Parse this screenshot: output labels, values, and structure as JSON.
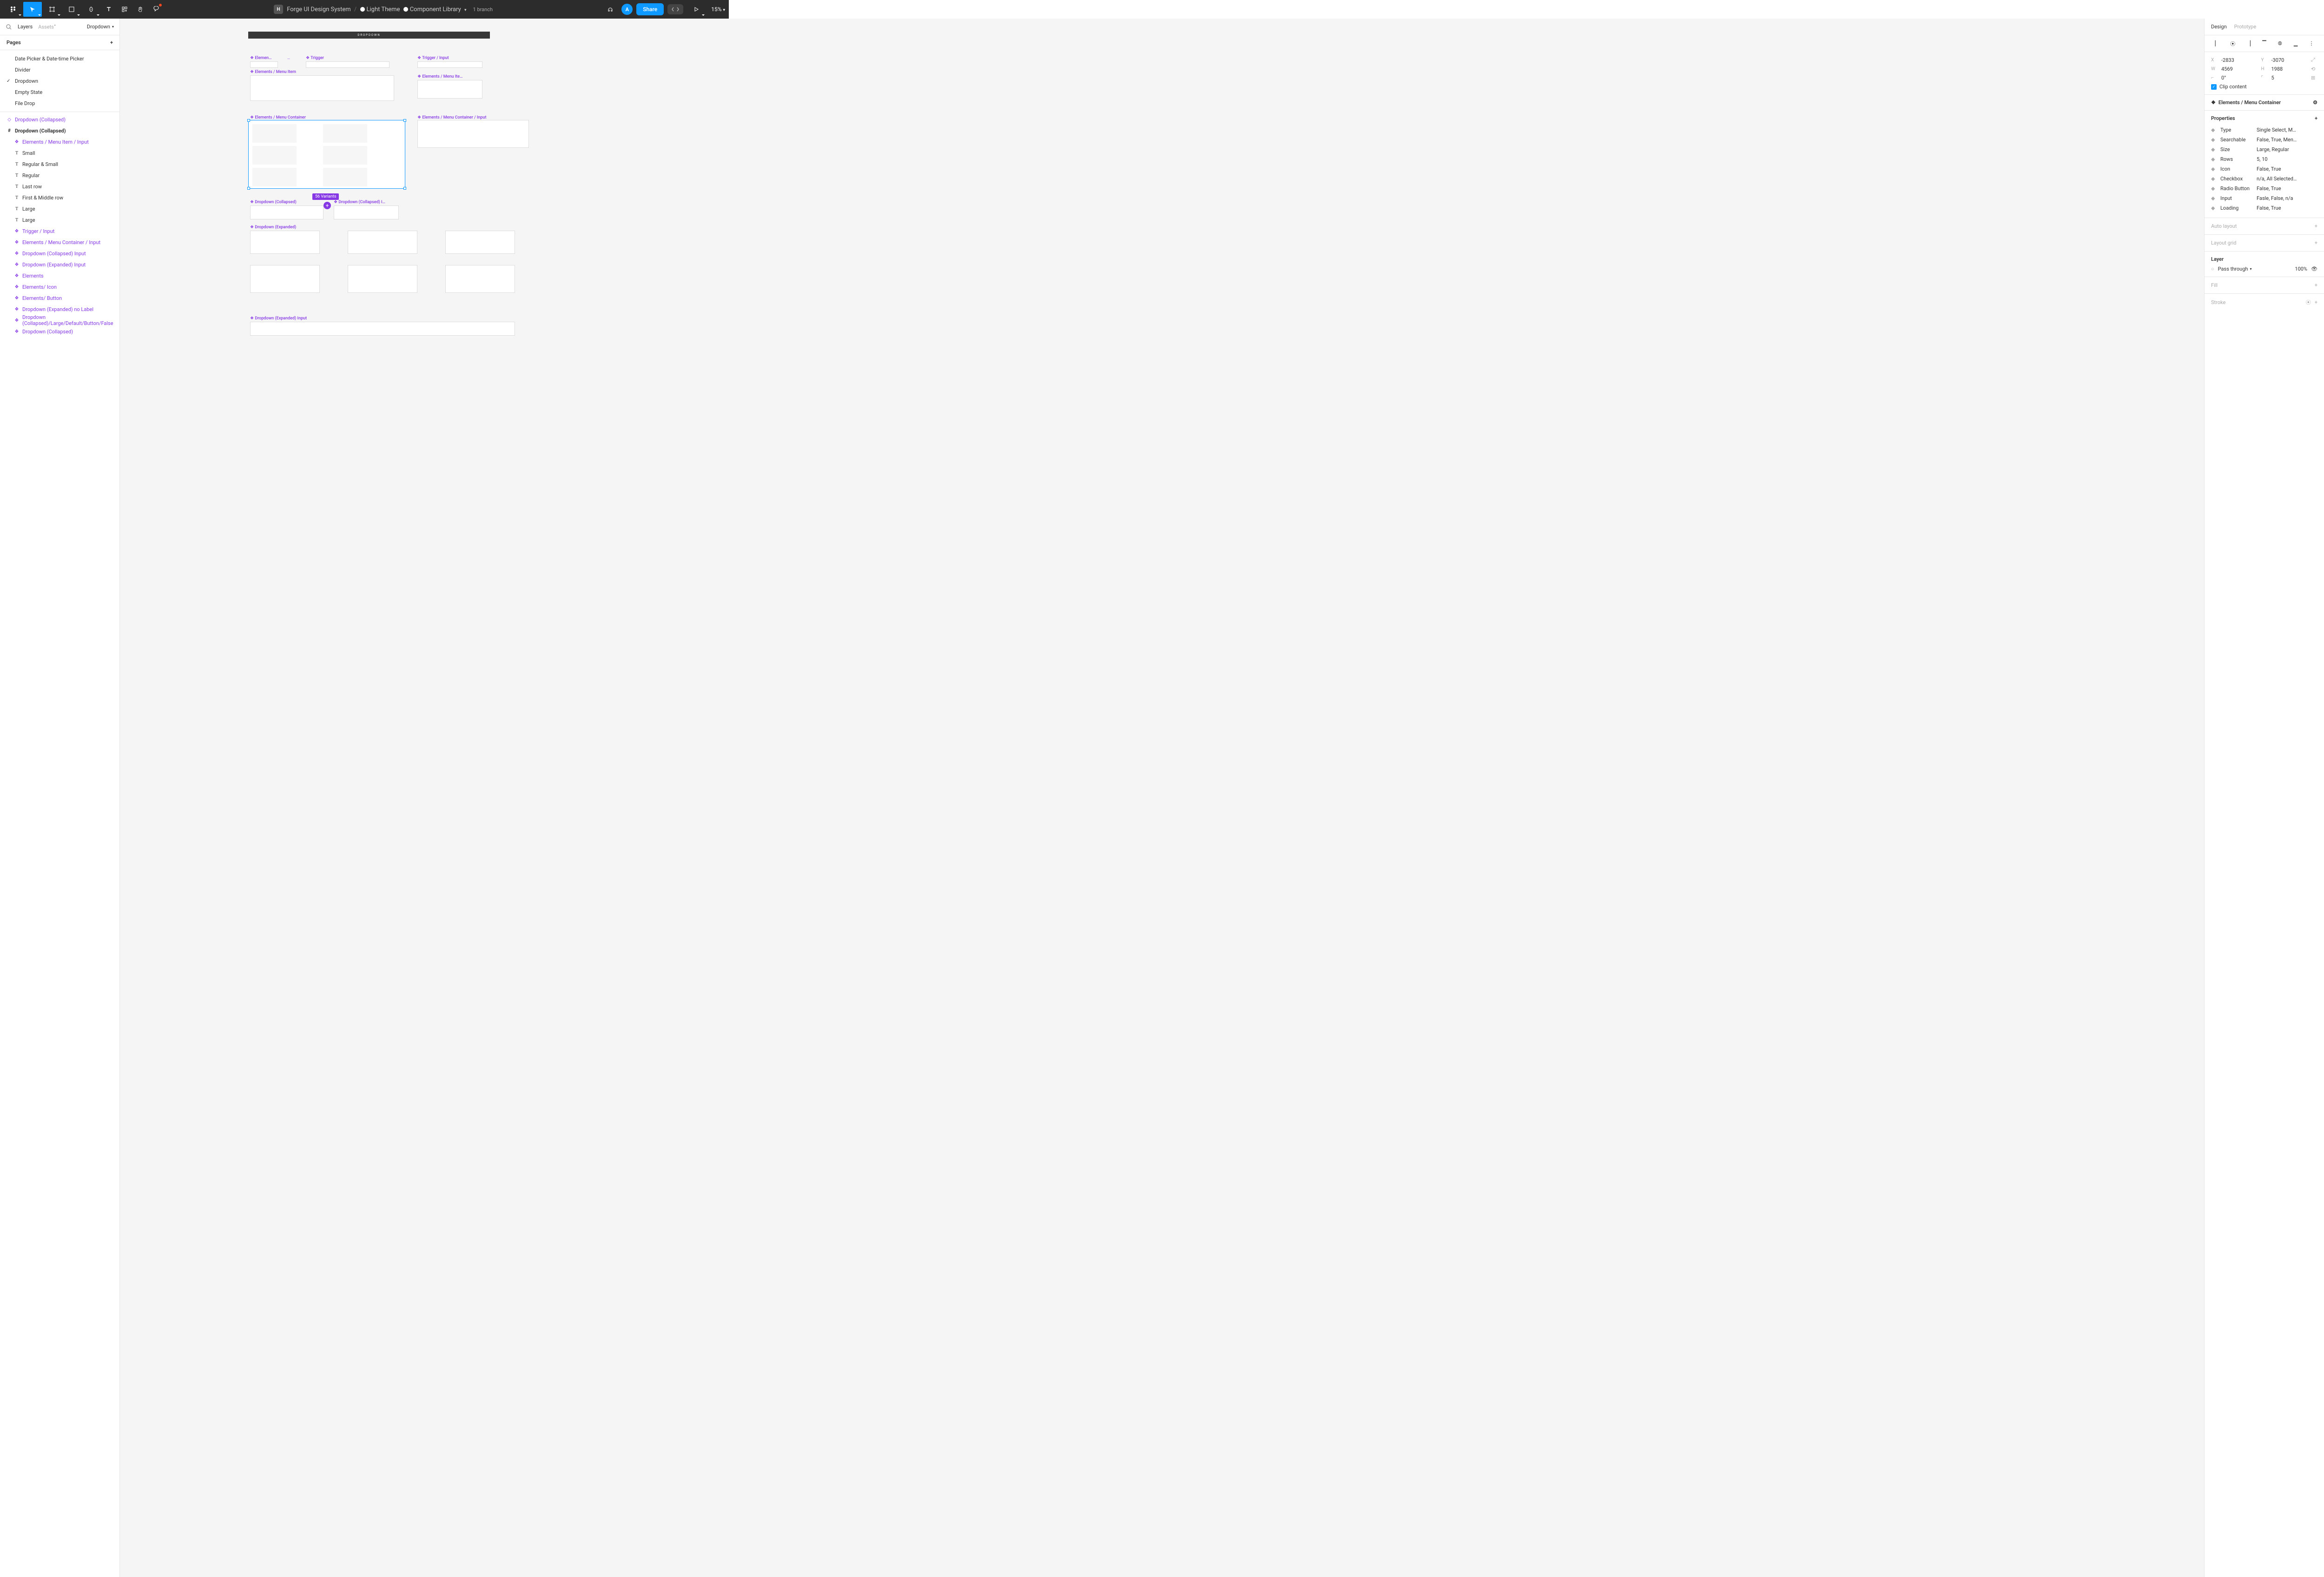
{
  "toolbar": {
    "project_avatar": "H",
    "project": "Forge UI Design System",
    "page_theme": "Light Theme",
    "page_section": "Component Library",
    "branch": "1 branch",
    "user_avatar": "A",
    "share": "Share",
    "zoom": "15%"
  },
  "left": {
    "tabs": {
      "layers": "Layers",
      "assets": "Assets"
    },
    "page_selector": "Dropdown",
    "pages_header": "Pages",
    "pages": [
      {
        "label": "Date Picker & Date-time Picker",
        "active": false
      },
      {
        "label": "Divider",
        "active": false
      },
      {
        "label": "Dropdown",
        "active": true
      },
      {
        "label": "Empty State",
        "active": false
      },
      {
        "label": "File Drop",
        "active": false
      }
    ],
    "layers": [
      {
        "label": "Dropdown (Collapsed)",
        "icon": "diamond",
        "style": "purple"
      },
      {
        "label": "Dropdown (Collapsed)",
        "icon": "frame",
        "style": "bold"
      },
      {
        "label": "Elements / Menu Item / Input",
        "icon": "component",
        "style": "purple indent"
      },
      {
        "label": "Small",
        "icon": "text",
        "style": "indent"
      },
      {
        "label": "Regular & Small",
        "icon": "text",
        "style": "indent"
      },
      {
        "label": "Regular",
        "icon": "text",
        "style": "indent"
      },
      {
        "label": "Last row",
        "icon": "text",
        "style": "indent"
      },
      {
        "label": "First & Middle row",
        "icon": "text",
        "style": "indent"
      },
      {
        "label": "Large",
        "icon": "text",
        "style": "indent"
      },
      {
        "label": "Large",
        "icon": "text",
        "style": "indent"
      },
      {
        "label": "Trigger / Input",
        "icon": "component",
        "style": "purple indent"
      },
      {
        "label": "Elements / Menu Container / Input",
        "icon": "component",
        "style": "purple indent"
      },
      {
        "label": "Dropdown (Collapsed) Input",
        "icon": "component",
        "style": "purple indent"
      },
      {
        "label": "Dropdown (Expanded) Input",
        "icon": "component",
        "style": "purple indent"
      },
      {
        "label": "Elements",
        "icon": "component",
        "style": "purple indent"
      },
      {
        "label": "Elements/ Icon",
        "icon": "component",
        "style": "purple indent"
      },
      {
        "label": "Elements/ Button",
        "icon": "component",
        "style": "purple indent"
      },
      {
        "label": "Dropdown (Expanded) no Label",
        "icon": "component",
        "style": "purple indent"
      },
      {
        "label": "Dropdown (Collapsed)/Large/Default/Button/False",
        "icon": "component",
        "style": "purple indent"
      },
      {
        "label": "Dropdown (Collapsed)",
        "icon": "component",
        "style": "purple indent"
      }
    ]
  },
  "canvas": {
    "frame_title": "DROPDOWN",
    "labels": {
      "l1": "Elemen…",
      "l2": "Trigger",
      "l3": "Trigger / Input",
      "l4": "Elements / Menu Item",
      "l5": "Elements / Menu Ite…",
      "l6": "Elements / Menu Container",
      "l7": "Elements / Menu Container / Input",
      "l8": "Dropdown (Collapsed)",
      "l9": "Dropdown (Collapsed) I…",
      "l10": "Dropdown (Expanded)",
      "l11": "Dropdown (Expanded) Input"
    },
    "variant_badge": "56 Variants",
    "ellipsis": "…"
  },
  "right": {
    "tabs": {
      "design": "Design",
      "prototype": "Prototype"
    },
    "dims": {
      "x_label": "X",
      "x": "-2833",
      "y_label": "Y",
      "y": "-3070",
      "w_label": "W",
      "w": "4569",
      "h_label": "H",
      "h": "1988",
      "rot_label": "⟲",
      "rot": "0°",
      "rad_label": "⌐",
      "rad": "5",
      "clip": "Clip content"
    },
    "component_name": "Elements / Menu Container",
    "properties_header": "Properties",
    "properties": [
      {
        "name": "Type",
        "value": "Single Select, M…"
      },
      {
        "name": "Searchable",
        "value": "False, True, Men…"
      },
      {
        "name": "Size",
        "value": "Large, Regular"
      },
      {
        "name": "Rows",
        "value": "5, 10"
      },
      {
        "name": "Icon",
        "value": "False, True"
      },
      {
        "name": "Checkbox",
        "value": "n/a, All Selected…"
      },
      {
        "name": "Radio Button",
        "value": "False, True"
      },
      {
        "name": "Input",
        "value": "Fasle, False, n/a"
      },
      {
        "name": "Loading",
        "value": "False, True"
      }
    ],
    "auto_layout": "Auto layout",
    "layout_grid": "Layout grid",
    "layer_header": "Layer",
    "blend_mode": "Pass through",
    "opacity": "100%",
    "fill": "Fill",
    "stroke": "Stroke"
  }
}
